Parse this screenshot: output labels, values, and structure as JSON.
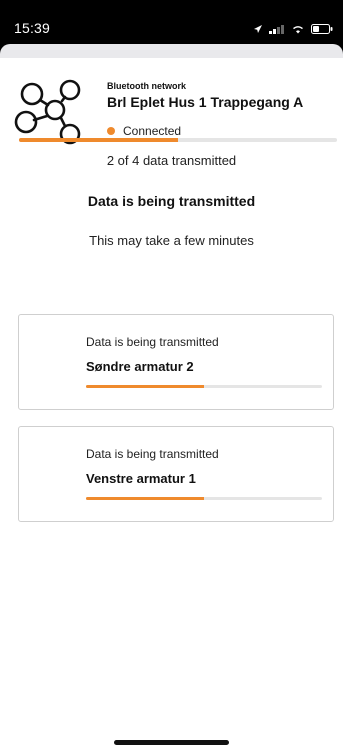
{
  "status_bar": {
    "time": "15:39",
    "icons": [
      "location-arrow-icon",
      "signal-icon",
      "wifi-icon",
      "battery-icon"
    ]
  },
  "header": {
    "network_kicker": "Bluetooth network",
    "network_name": "Brl Eplet Hus 1 Trappegang A",
    "status_text": "Connected",
    "status_color": "#ef8a2d"
  },
  "overall": {
    "title": "Data is being transmitted",
    "subtitle": "This may take a few minutes",
    "progress_fraction": 0.5,
    "count_text": "2 of 4 data transmitted"
  },
  "devices": [
    {
      "kicker": "Data is being transmitted",
      "name": "Søndre armatur 2",
      "progress_fraction": 0.5
    },
    {
      "kicker": "Data is being transmitted",
      "name": "Venstre armatur 1",
      "progress_fraction": 0.5
    }
  ],
  "colors": {
    "accent": "#ef8a2d",
    "track": "#e5e5e5",
    "text": "#111111"
  }
}
